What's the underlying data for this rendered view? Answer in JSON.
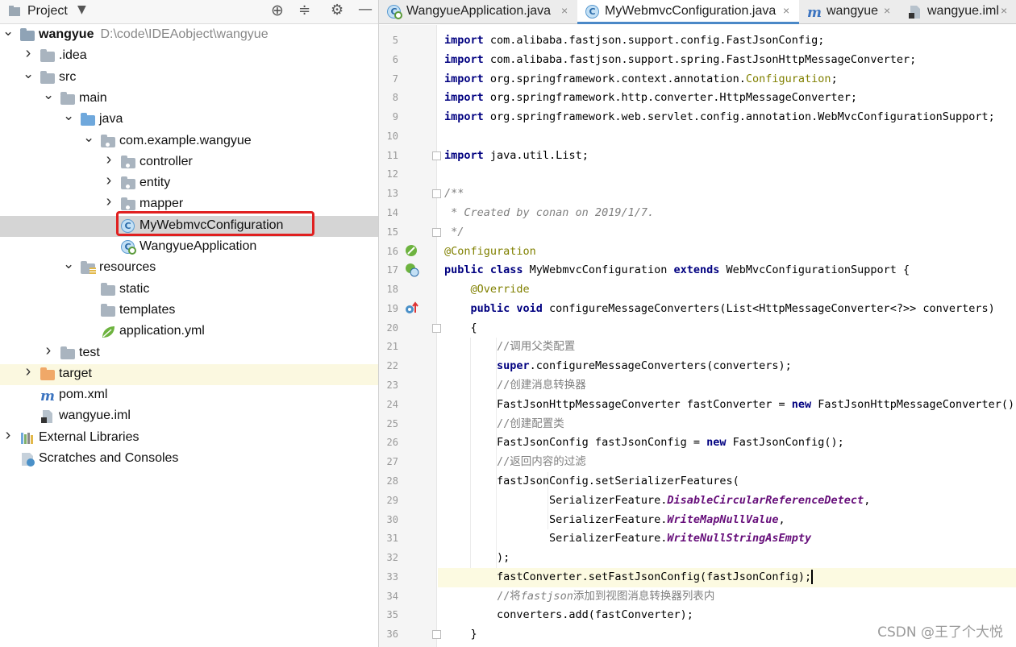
{
  "project_panel": {
    "title": "Project",
    "tree": [
      {
        "label": "wangyue",
        "sub": "D:\\code\\IDEAobject\\wangyue",
        "depth": 0,
        "arrow": "down",
        "icon": "module-folder-icon",
        "bold": true
      },
      {
        "label": ".idea",
        "depth": 1,
        "arrow": "right",
        "icon": "folder-icon"
      },
      {
        "label": "src",
        "depth": 1,
        "arrow": "down",
        "icon": "folder-icon"
      },
      {
        "label": "main",
        "depth": 2,
        "arrow": "down",
        "icon": "folder-icon"
      },
      {
        "label": "java",
        "depth": 3,
        "arrow": "down",
        "icon": "source-folder-icon"
      },
      {
        "label": "com.example.wangyue",
        "depth": 4,
        "arrow": "down",
        "icon": "package-icon"
      },
      {
        "label": "controller",
        "depth": 5,
        "arrow": "right",
        "icon": "package-icon"
      },
      {
        "label": "entity",
        "depth": 5,
        "arrow": "right",
        "icon": "package-icon"
      },
      {
        "label": "mapper",
        "depth": 5,
        "arrow": "right",
        "icon": "package-icon"
      },
      {
        "label": "MyWebmvcConfiguration",
        "depth": 5,
        "arrow": "none",
        "icon": "class-icon",
        "selected": true
      },
      {
        "label": "WangyueApplication",
        "depth": 5,
        "arrow": "none",
        "icon": "spring-class-icon"
      },
      {
        "label": "resources",
        "depth": 3,
        "arrow": "down",
        "icon": "resources-folder-icon"
      },
      {
        "label": "static",
        "depth": 4,
        "arrow": "none",
        "icon": "folder-icon"
      },
      {
        "label": "templates",
        "depth": 4,
        "arrow": "none",
        "icon": "folder-icon"
      },
      {
        "label": "application.yml",
        "depth": 4,
        "arrow": "none",
        "icon": "spring-leaf-icon"
      },
      {
        "label": "test",
        "depth": 2,
        "arrow": "right",
        "icon": "folder-icon"
      },
      {
        "label": "target",
        "depth": 1,
        "arrow": "right",
        "icon": "excluded-folder-icon",
        "highlight": true
      },
      {
        "label": "pom.xml",
        "depth": 1,
        "arrow": "none",
        "icon": "maven-icon"
      },
      {
        "label": "wangyue.iml",
        "depth": 1,
        "arrow": "none",
        "icon": "iml-file-icon"
      },
      {
        "label": "External Libraries",
        "depth": 0,
        "arrow": "right",
        "icon": "libraries-icon"
      },
      {
        "label": "Scratches and Consoles",
        "depth": 0,
        "arrow": "none",
        "icon": "scratches-icon"
      }
    ]
  },
  "tabs": [
    {
      "label": "WangyueApplication.java",
      "icon": "spring-class-icon",
      "active": false
    },
    {
      "label": "MyWebmvcConfiguration.java",
      "icon": "class-icon",
      "active": true
    },
    {
      "label": "wangyue",
      "icon": "maven-icon",
      "active": false
    },
    {
      "label": "wangyue.iml",
      "icon": "iml-file-icon",
      "active": false
    }
  ],
  "code_lines": [
    {
      "n": "5",
      "html": "<span class='kw'>import</span> com.alibaba.fastjson.support.config.FastJsonConfig;"
    },
    {
      "n": "6",
      "html": "<span class='kw'>import</span> com.alibaba.fastjson.support.spring.FastJsonHttpMessageConverter;"
    },
    {
      "n": "7",
      "html": "<span class='kw'>import</span> org.springframework.context.annotation.<span class='ann'>Configuration</span>;"
    },
    {
      "n": "8",
      "html": "<span class='kw'>import</span> org.springframework.http.converter.HttpMessageConverter;"
    },
    {
      "n": "9",
      "html": "<span class='kw'>import</span> org.springframework.web.servlet.config.annotation.WebMvcConfigurationSupport;"
    },
    {
      "n": "10",
      "html": ""
    },
    {
      "n": "11",
      "html": "<span class='kw'>import</span> java.util.List;"
    },
    {
      "n": "12",
      "html": ""
    },
    {
      "n": "13",
      "html": "<span class='cm'>/**</span>"
    },
    {
      "n": "14",
      "html": "<span class='cm'> * Created by conan on 2019/1/7.</span>"
    },
    {
      "n": "15",
      "html": "<span class='cm'> */</span>"
    },
    {
      "n": "16",
      "html": "<span class='ann'>@Configuration</span>"
    },
    {
      "n": "17",
      "html": "<span class='kw'>public class</span> MyWebmvcConfiguration <span class='kw'>extends</span> WebMvcConfigurationSupport {"
    },
    {
      "n": "18",
      "html": "    <span class='ann'>@Override</span>"
    },
    {
      "n": "19",
      "html": "    <span class='kw'>public void</span> configureMessageConverters(List&lt;HttpMessageConverter&lt;?&gt;&gt; converters)"
    },
    {
      "n": "20",
      "html": "    {"
    },
    {
      "n": "21",
      "html": "        <span class='cmcn'>//调用父类配置</span>"
    },
    {
      "n": "22",
      "html": "        <span class='kw'>super</span>.configureMessageConverters(converters);"
    },
    {
      "n": "23",
      "html": "        <span class='cmcn'>//创建消息转换器</span>"
    },
    {
      "n": "24",
      "html": "        FastJsonHttpMessageConverter fastConverter = <span class='kw'>new</span> FastJsonHttpMessageConverter();"
    },
    {
      "n": "25",
      "html": "        <span class='cmcn'>//创建配置类</span>"
    },
    {
      "n": "26",
      "html": "        FastJsonConfig fastJsonConfig = <span class='kw'>new</span> FastJsonConfig();"
    },
    {
      "n": "27",
      "html": "        <span class='cmcn'>//返回内容的过滤</span>"
    },
    {
      "n": "28",
      "html": "        fastJsonConfig.setSerializerFeatures("
    },
    {
      "n": "29",
      "html": "                SerializerFeature.<span class='fld'>DisableCircularReferenceDetect</span>,"
    },
    {
      "n": "30",
      "html": "                SerializerFeature.<span class='fld'>WriteMapNullValue</span>,"
    },
    {
      "n": "31",
      "html": "                SerializerFeature.<span class='fld'>WriteNullStringAsEmpty</span>"
    },
    {
      "n": "32",
      "html": "        );"
    },
    {
      "n": "33",
      "html": "        fastConverter.setFastJsonConfig(fastJsonConfig);<span class='caret'></span>",
      "caret": true
    },
    {
      "n": "34",
      "html": "        <span class='cmcn'>//将<i>fastjson</i>添加到视图消息转换器列表内</span>"
    },
    {
      "n": "35",
      "html": "        converters.add(fastConverter);"
    },
    {
      "n": "36",
      "html": "    }"
    }
  ],
  "gutter_icons": {
    "16": "spring-bean-icon",
    "17": "spring-class-icon",
    "19": "override-method-icon"
  },
  "folds": [
    "11",
    "13",
    "15",
    "20",
    "36"
  ],
  "watermark": "CSDN @王了个大悦",
  "colors": {
    "keyword": "#000080",
    "annotation": "#808000",
    "comment": "#808080",
    "field": "#660e7a",
    "selection": "#d5d5d5",
    "red_box": "#e02020"
  }
}
